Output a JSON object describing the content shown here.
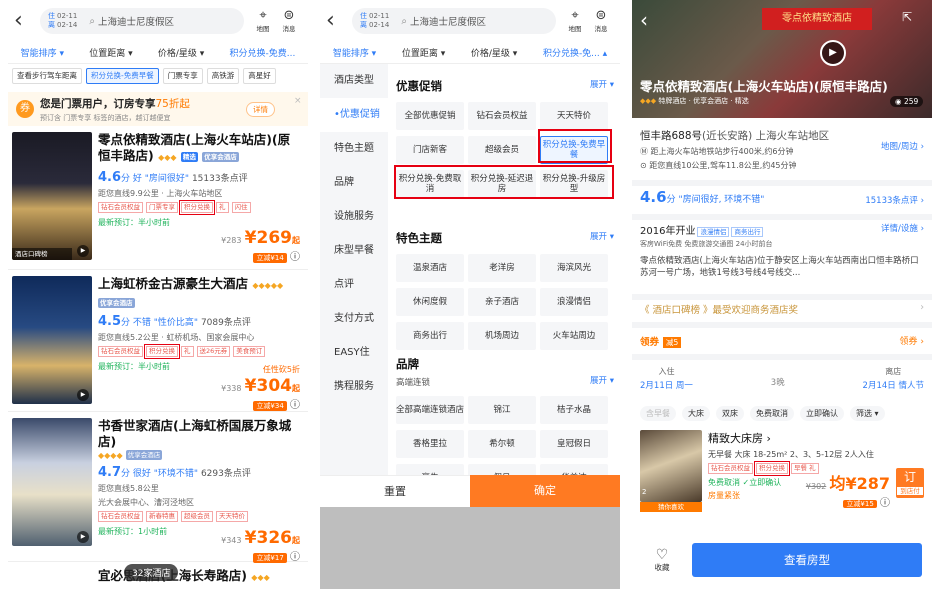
{
  "search": {
    "checkin_label": "住",
    "checkin_date": "02-11",
    "checkout_label": "离",
    "checkout_date": "02-14",
    "query": "上海迪士尼度假区",
    "map_label": "地图",
    "msg_label": "消息"
  },
  "filters": [
    "智能排序 ▾",
    "位置距离 ▾",
    "价格/星级 ▾",
    "积分兑换-免费..."
  ],
  "filters2": [
    "智能排序 ▾",
    "位置距离 ▾",
    "价格/星级 ▾",
    "积分兑换-免... ▴"
  ],
  "quick_tags": [
    "查看步行驾车距离",
    "积分兑换-免费早餐",
    "门票专享",
    "高铁游",
    "高星好"
  ],
  "promo": {
    "title": "您是门票用户，订房专享",
    "highlight": "75折起",
    "subtitle": "预订含 门票专享 标签的酒店，越订越便宜",
    "button": "详情",
    "close": "×"
  },
  "hotels": [
    {
      "name": "零点依精致酒店(上海火车站店)(原恒丰路店)",
      "stars": "◆◆◆",
      "badges": [
        "精选",
        "优享会酒店"
      ],
      "score": "4.6",
      "score_word": "分 好",
      "quote": "\"房间很好\"",
      "reviews": "15133条点评",
      "dist": "距您直线9.9公里 · 上海火车站地区",
      "tags": [
        "钻石会员权益",
        "门票专享",
        "积分兑换",
        "礼",
        "闪住"
      ],
      "recent": "最新预订：半小时前",
      "orig": "¥283",
      "price": "269",
      "cut": "立减¥14",
      "img_badge": "酒店口碑榜"
    },
    {
      "name": "上海虹桥金古源豪生大酒店",
      "stars": "◆◆◆◆◆",
      "badges": [
        "优享会酒店"
      ],
      "score": "4.5",
      "score_word": "分 不错",
      "quote": "\"性价比高\"",
      "reviews": "7089条点评",
      "dist": "距您直线5.2公里 · 虹桥机场、国家会展中心",
      "tags": [
        "钻石会员权益",
        "积分兑换",
        "礼",
        "送26元券",
        "美食预订"
      ],
      "recent": "最新预订：半小时前",
      "deal": "任性砍5折",
      "orig": "¥338",
      "price": "304",
      "cut": "立减¥34"
    },
    {
      "name": "书香世家酒店(上海虹桥国展万象城店)",
      "stars": "◆◆◆◆",
      "badges": [
        "优享会酒店"
      ],
      "score": "4.7",
      "score_word": "分 很好",
      "quote": "\"环境不错\"",
      "reviews": "6293条点评",
      "dist": "距您直线5.8公里",
      "area": "光大会展中心、漕河泾地区",
      "tags": [
        "钻石会员权益",
        "新春特惠",
        "超级会员",
        "天天特价"
      ],
      "recent": "最新预订：1小时前",
      "orig": "¥343",
      "price": "326",
      "cut": "立减¥17"
    },
    {
      "name": "宜必思酒店(上海长寿路店)",
      "stars": "◆◆◆"
    }
  ],
  "hotel_count": "32家酒店",
  "panel": {
    "left": [
      "酒店类型",
      "•优惠促销",
      "特色主题",
      "品牌",
      "设施服务",
      "床型早餐",
      "点评",
      "支付方式",
      "EASY住",
      "携程服务"
    ],
    "promo_title": "优惠促销",
    "expand": "展开 ▾",
    "promo_items": [
      "全部优惠促销",
      "钻石会员权益",
      "天天特价",
      "门店新客",
      "超级会员",
      "积分兑换-免费早餐",
      "积分兑换-免费取消",
      "积分兑换-延迟退房",
      "积分兑换-升级房型"
    ],
    "theme_title": "特色主题",
    "theme_items": [
      "温泉酒店",
      "老洋房",
      "海滨风光",
      "休闲度假",
      "亲子酒店",
      "浪漫情侣",
      "商务出行",
      "机场周边",
      "火车站周边"
    ],
    "brand_title": "品牌",
    "brand_sub": "高端连锁",
    "brand_items": [
      "全部高端连锁酒店",
      "锦江",
      "桔子水晶",
      "香格里拉",
      "希尔顿",
      "皇冠假日",
      "豪生",
      "假日",
      "华美达"
    ],
    "reset": "重置",
    "ok": "确定"
  },
  "detail": {
    "name": "零点依精致酒店(上海火车站店)(原恒丰路店)",
    "sign": "零点依精致酒店",
    "meta": [
      "◆◆◆",
      "特牌酒店",
      "优享会酒店",
      "精选"
    ],
    "photos": "259",
    "addr": "恒丰路688号",
    "addr_area": "(近长安路) 上海火车站地区",
    "map": "地图/周边 ›",
    "near1": "距上海火车站地铁站步行400米,约6分钟",
    "near2": "距您直线10公里,驾车11.8公里,约45分钟",
    "score": "4.6",
    "score_text": "分 \"房间很好, 环境不错\"",
    "reviews": "15133条点评 ›",
    "open": "2016年开业",
    "open_tags": [
      "浪漫情侣",
      "商务出行"
    ],
    "amenities": "客房WiFi免费  免费旅游交通图  24小时前台",
    "desc": "零点依精致酒店(上海火车站店)位于静安区上海火车站西南出口恒丰路桥口苏河一号广场，地铁1号线3号线4号线交...",
    "facility": "详情/设施 ›",
    "award": "《 酒店口碑榜 》最受欢迎商务酒店奖",
    "coupon": "领券",
    "coupon_tag": "减5",
    "get_coupon": "领券 ›",
    "in_label": "入住",
    "in_date": "2月11日 周一",
    "nights": "3晚",
    "out_label": "离店",
    "out_date": "2月14日 情人节",
    "room_filters": [
      "含早餐",
      "大床",
      "双床",
      "免费取消",
      "立即确认",
      "筛选 ▾"
    ],
    "room": {
      "name": "精致大床房 ›",
      "desc": "无早餐 大床 18-25m²  2、3、5-12层 2人入住",
      "tags": [
        "钻石会员权益",
        "积分兑换",
        "早餐 礼"
      ],
      "cancel": "免费取消  ✓立即确认",
      "scarce": "房量紧张",
      "orig": "¥302",
      "price": "均¥287",
      "cut": "立减¥15",
      "book": "订",
      "pay": "到店付",
      "img_count": "2",
      "img_label": "猜你喜欢"
    },
    "fav": "收藏",
    "view": "查看房型"
  },
  "colors": {
    "accent": "#2f7cf6",
    "price": "#ff6a00",
    "highlight_box": "#e60012"
  }
}
